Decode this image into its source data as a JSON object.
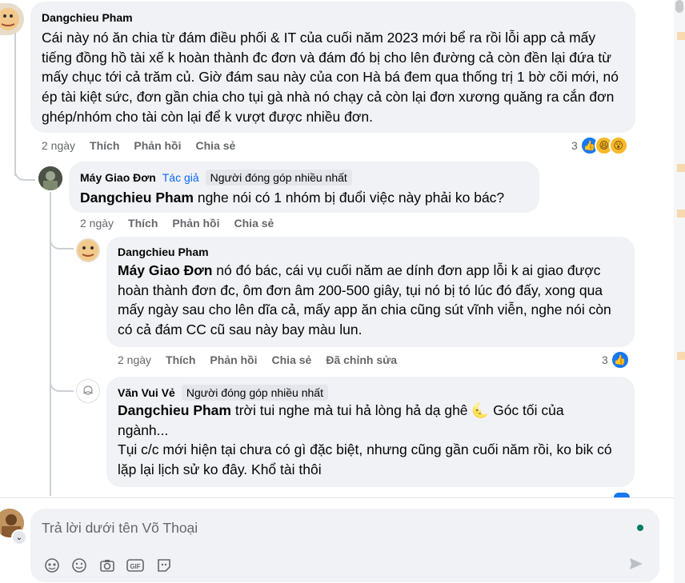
{
  "comments": [
    {
      "author": "Dangchieu Pham",
      "text": "Cái này nó ăn chia từ đám điều phối & IT của cuối năm 2023 mới bể ra rồi lỗi app cả mấy tiếng đồng hồ tài xế k hoàn thành đc đơn và đám đó bị cho lên đường cả còn đền lại đứa từ mấy chục tới cả trăm củ. Giờ đám sau này của con Hà bá đem qua thống trị 1 bờ cõi mới, nó ép tài kiệt sức, đơn gần chia cho tụi gà nhà nó chạy cả còn lại đơn xương quăng ra cắn đơn ghép/nhóm cho tài còn lại để k vượt được nhiều đơn.",
      "time": "2 ngày",
      "like": "Thích",
      "reply": "Phản hồi",
      "share": "Chia sẻ",
      "reaction_count": "3"
    },
    {
      "author": "Máy Giao Đơn",
      "badge_author": "Tác giả",
      "badge_contributor": "Người đóng góp nhiều nhất",
      "mention": "Dangchieu Pham",
      "text": " nghe nói có 1 nhóm bị đuổi việc này phải ko bác?",
      "time": "2 ngày",
      "like": "Thích",
      "reply": "Phản hồi",
      "share": "Chia sẻ"
    },
    {
      "author": "Dangchieu Pham",
      "mention": "Máy Giao Đơn",
      "text": " nó đó bác, cái vụ cuối năm ae dính đơn app lỗi k ai giao được hoàn thành đơn đc, ôm đơn âm 200-500 giây, tụi nó bị tó lúc đó đấy, xong qua mấy ngày sau cho lên dĩa cả, mấy app ăn chia cũng sút vĩnh viễn, nghe nói còn có cả đám CC cũ sau này bay màu lun.",
      "time": "2 ngày",
      "like": "Thích",
      "reply": "Phản hồi",
      "share": "Chia sẻ",
      "edited": "Đã chỉnh sửa",
      "reaction_count": "3"
    },
    {
      "author": "Văn Vui Vẻ",
      "badge_contributor": "Người đóng góp nhiều nhất",
      "mention": "Dangchieu Pham",
      "text_line1": " trời tui nghe mà tui hả lòng hả dạ ghê ",
      "text_line1_tail": " Góc tối của ngành...",
      "text_rest": "Tụi c/c mới hiện tại chưa có gì đặc biệt, nhưng cũng gần cuối năm rồi, ko bik có lặp lại lịch sử ko đây. Khổ tài thôi"
    }
  ],
  "composer": {
    "placeholder": "Trả lời dưới tên Võ Thoại"
  },
  "icons": [
    "like-icon",
    "haha-icon",
    "wow-icon",
    "sticker-icon",
    "emoji-icon",
    "camera-icon",
    "gif-icon",
    "avatar-sticker-icon",
    "send-icon"
  ]
}
